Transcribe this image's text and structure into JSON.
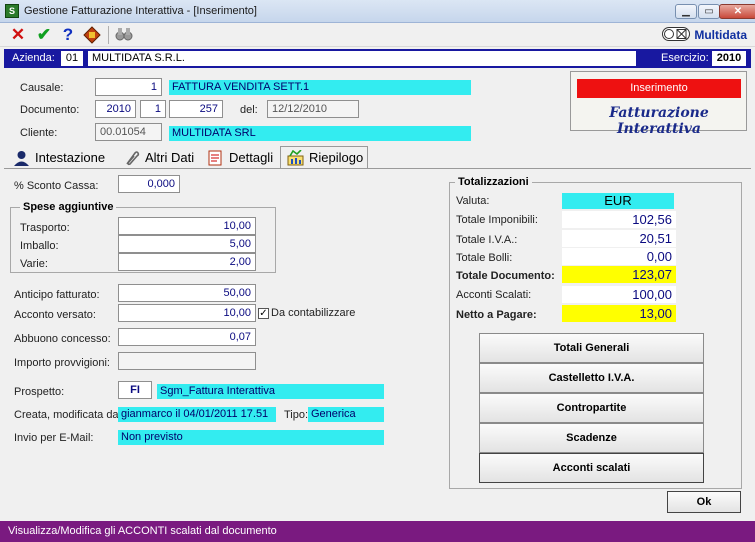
{
  "window": {
    "title": "Gestione Fatturazione Interattiva - [Inserimento]"
  },
  "toolbar": {
    "brand": "Multidata"
  },
  "header": {
    "azienda_label": "Azienda:",
    "azienda_code": "01",
    "azienda_name": "MULTIDATA S.R.L.",
    "esercizio_label": "Esercizio:",
    "esercizio_value": "2010"
  },
  "form": {
    "causale_label": "Causale:",
    "causale_code": "1",
    "causale_desc": "FATTURA VENDITA SETT.1",
    "documento_label": "Documento:",
    "doc_year": "2010",
    "doc_series": "1",
    "doc_number": "257",
    "del_label": "del:",
    "doc_date": "12/12/2010",
    "cliente_label": "Cliente:",
    "cliente_code": "00.01054",
    "cliente_name": "MULTIDATA SRL"
  },
  "badge": {
    "mode": "Inserimento",
    "logo_text": "Fatturazione Interattiva"
  },
  "tabs": [
    "Intestazione",
    "Altri Dati",
    "Dettagli",
    "Riepilogo"
  ],
  "riepilogo": {
    "sconto_label": "% Sconto Cassa:",
    "sconto_value": "0,000",
    "spese_title": "Spese aggiuntive",
    "trasporto_label": "Trasporto:",
    "trasporto_value": "10,00",
    "imballo_label": "Imballo:",
    "imballo_value": "5,00",
    "varie_label": "Varie:",
    "varie_value": "2,00",
    "anticipo_label": "Anticipo fatturato:",
    "anticipo_value": "50,00",
    "acconto_label": "Acconto versato:",
    "acconto_value": "10,00",
    "contabilizzare_label": "Da contabilizzare",
    "contabilizzare_checked": "✓",
    "abbuono_label": "Abbuono concesso:",
    "abbuono_value": "0,07",
    "provvigioni_label": "Importo provvigioni:",
    "provvigioni_value": "",
    "prospetto_label": "Prospetto:",
    "prospetto_code": "FI",
    "prospetto_desc": "Sgm_Fattura Interattiva",
    "creata_label": "Creata, modificata da:",
    "creata_value": "gianmarco il 04/01/2011 17.51",
    "tipo_label": "Tipo:",
    "tipo_value": "Generica",
    "email_label": "Invio per E-Mail:",
    "email_value": "Non previsto"
  },
  "totali": {
    "title": "Totalizzazioni",
    "valuta_label": "Valuta:",
    "valuta_value": "EUR",
    "imponibili_label": "Totale Imponibili:",
    "imponibili_value": "102,56",
    "iva_label": "Totale I.V.A.:",
    "iva_value": "20,51",
    "bolli_label": "Totale Bolli:",
    "bolli_value": "0,00",
    "documento_label": "Totale Documento:",
    "documento_value": "123,07",
    "acconti_label": "Acconti Scalati:",
    "acconti_value": "100,00",
    "netto_label": "Netto a Pagare:",
    "netto_value": "13,00"
  },
  "buttons": [
    "Totali Generali",
    "Castelletto I.V.A.",
    "Contropartite",
    "Scadenze",
    "Acconti scalati"
  ],
  "ok_label": "Ok",
  "status": "Visualizza/Modifica gli ACCONTI scalati dal documento"
}
